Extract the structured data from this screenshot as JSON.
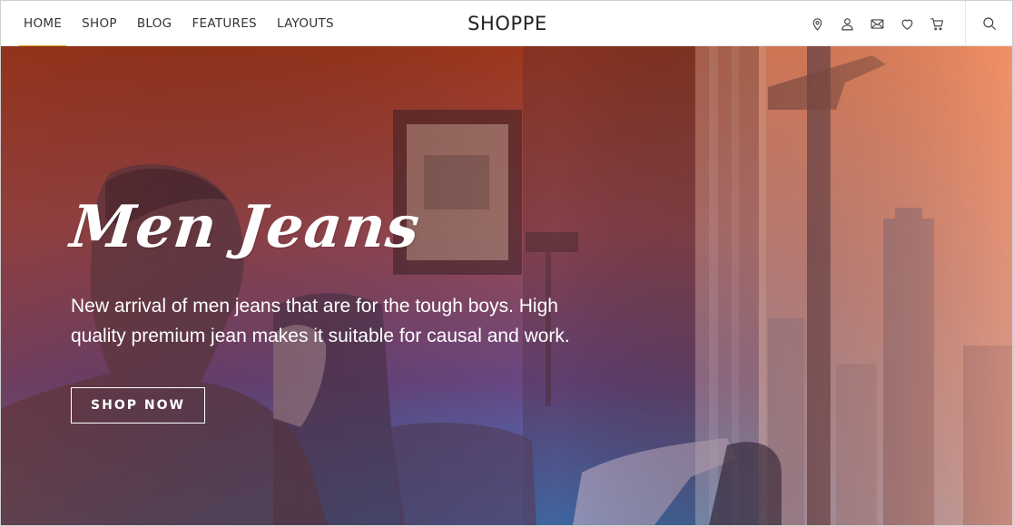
{
  "header": {
    "nav": [
      {
        "label": "HOME",
        "active": true
      },
      {
        "label": "SHOP",
        "active": false
      },
      {
        "label": "BLOG",
        "active": false
      },
      {
        "label": "FEATURES",
        "active": false
      },
      {
        "label": "LAYOUTS",
        "active": false
      }
    ],
    "brand": "SHOPPE",
    "icons": [
      "location-pin-icon",
      "user-icon",
      "mail-icon",
      "heart-icon",
      "cart-icon"
    ],
    "search_icon": "search-icon",
    "accent_color": "#e0a21a"
  },
  "hero": {
    "title": "Men Jeans",
    "text": "New arrival of men jeans that are for the tough boys. High quality premium jean makes it suitable for causal and work.",
    "cta_label": "SHOP NOW",
    "gradient_colors": [
      "#a33a1c",
      "#e06a4c",
      "#6a4a8a",
      "#3d7cc4"
    ]
  }
}
